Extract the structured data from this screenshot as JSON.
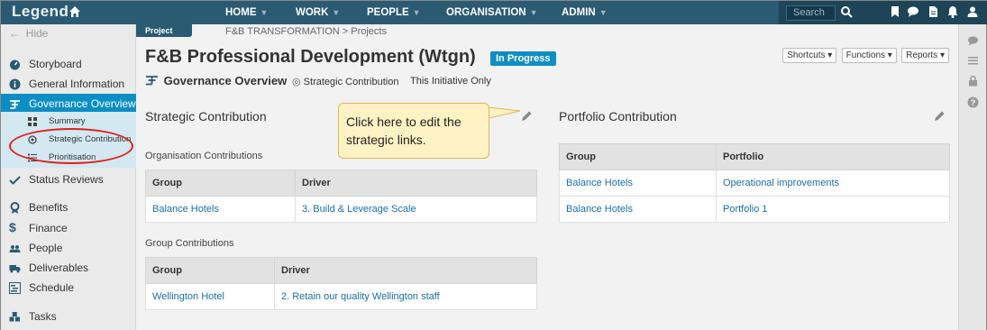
{
  "app": {
    "logo": "Legend"
  },
  "nav": [
    {
      "label": "HOME"
    },
    {
      "label": "WORK"
    },
    {
      "label": "PEOPLE"
    },
    {
      "label": "ORGANISATION"
    },
    {
      "label": "ADMIN"
    }
  ],
  "search": {
    "placeholder": "Search"
  },
  "sidebar": {
    "hide_label": "Hide",
    "items": [
      {
        "label": "Storyboard",
        "icon": "dashboard-icon"
      },
      {
        "label": "General Information",
        "icon": "info-icon"
      },
      {
        "label": "Governance Overview",
        "icon": "governance-icon"
      },
      {
        "label": "Status Reviews",
        "icon": "check-icon"
      },
      {
        "label": "Benefits",
        "icon": "award-icon"
      },
      {
        "label": "Finance",
        "icon": "dollar-icon"
      },
      {
        "label": "People",
        "icon": "people-icon"
      },
      {
        "label": "Deliverables",
        "icon": "truck-icon"
      },
      {
        "label": "Schedule",
        "icon": "schedule-icon"
      },
      {
        "label": "Tasks",
        "icon": "cubes-icon"
      }
    ],
    "subitems": [
      {
        "label": "Summary"
      },
      {
        "label": "Strategic Contribution"
      },
      {
        "label": "Prioritisation"
      }
    ]
  },
  "header": {
    "badge": "Project",
    "breadcrumb": "F&B TRANSFORMATION > Projects",
    "title": "F&B Professional Development (Wtgn)",
    "status": "In Progress",
    "buttons": [
      "Shortcuts",
      "Functions",
      "Reports"
    ],
    "subtitle": "Governance Overview",
    "view": "Strategic Contribution",
    "scope": "This Initiative Only"
  },
  "strategic": {
    "title": "Strategic Contribution",
    "org_title": "Organisation Contributions",
    "org_headers": [
      "Group",
      "Driver"
    ],
    "org_rows": [
      [
        "Balance Hotels",
        "3. Build & Leverage Scale"
      ]
    ],
    "group_title": "Group Contributions",
    "group_headers": [
      "Group",
      "Driver"
    ],
    "group_rows": [
      [
        "Wellington Hotel",
        "2. Retain our quality Wellington staff"
      ]
    ]
  },
  "portfolio": {
    "title": "Portfolio Contribution",
    "headers": [
      "Group",
      "Portfolio"
    ],
    "rows": [
      [
        "Balance Hotels",
        "Operational improvements"
      ],
      [
        "Balance Hotels",
        "Portfolio 1"
      ]
    ]
  },
  "callout": {
    "text": "Click here to edit the strategic  links."
  },
  "colors": {
    "topbar": "#2b5a73",
    "accent": "#0c8ec4",
    "highlight": "#e0201a",
    "link": "#1a6fa8"
  }
}
